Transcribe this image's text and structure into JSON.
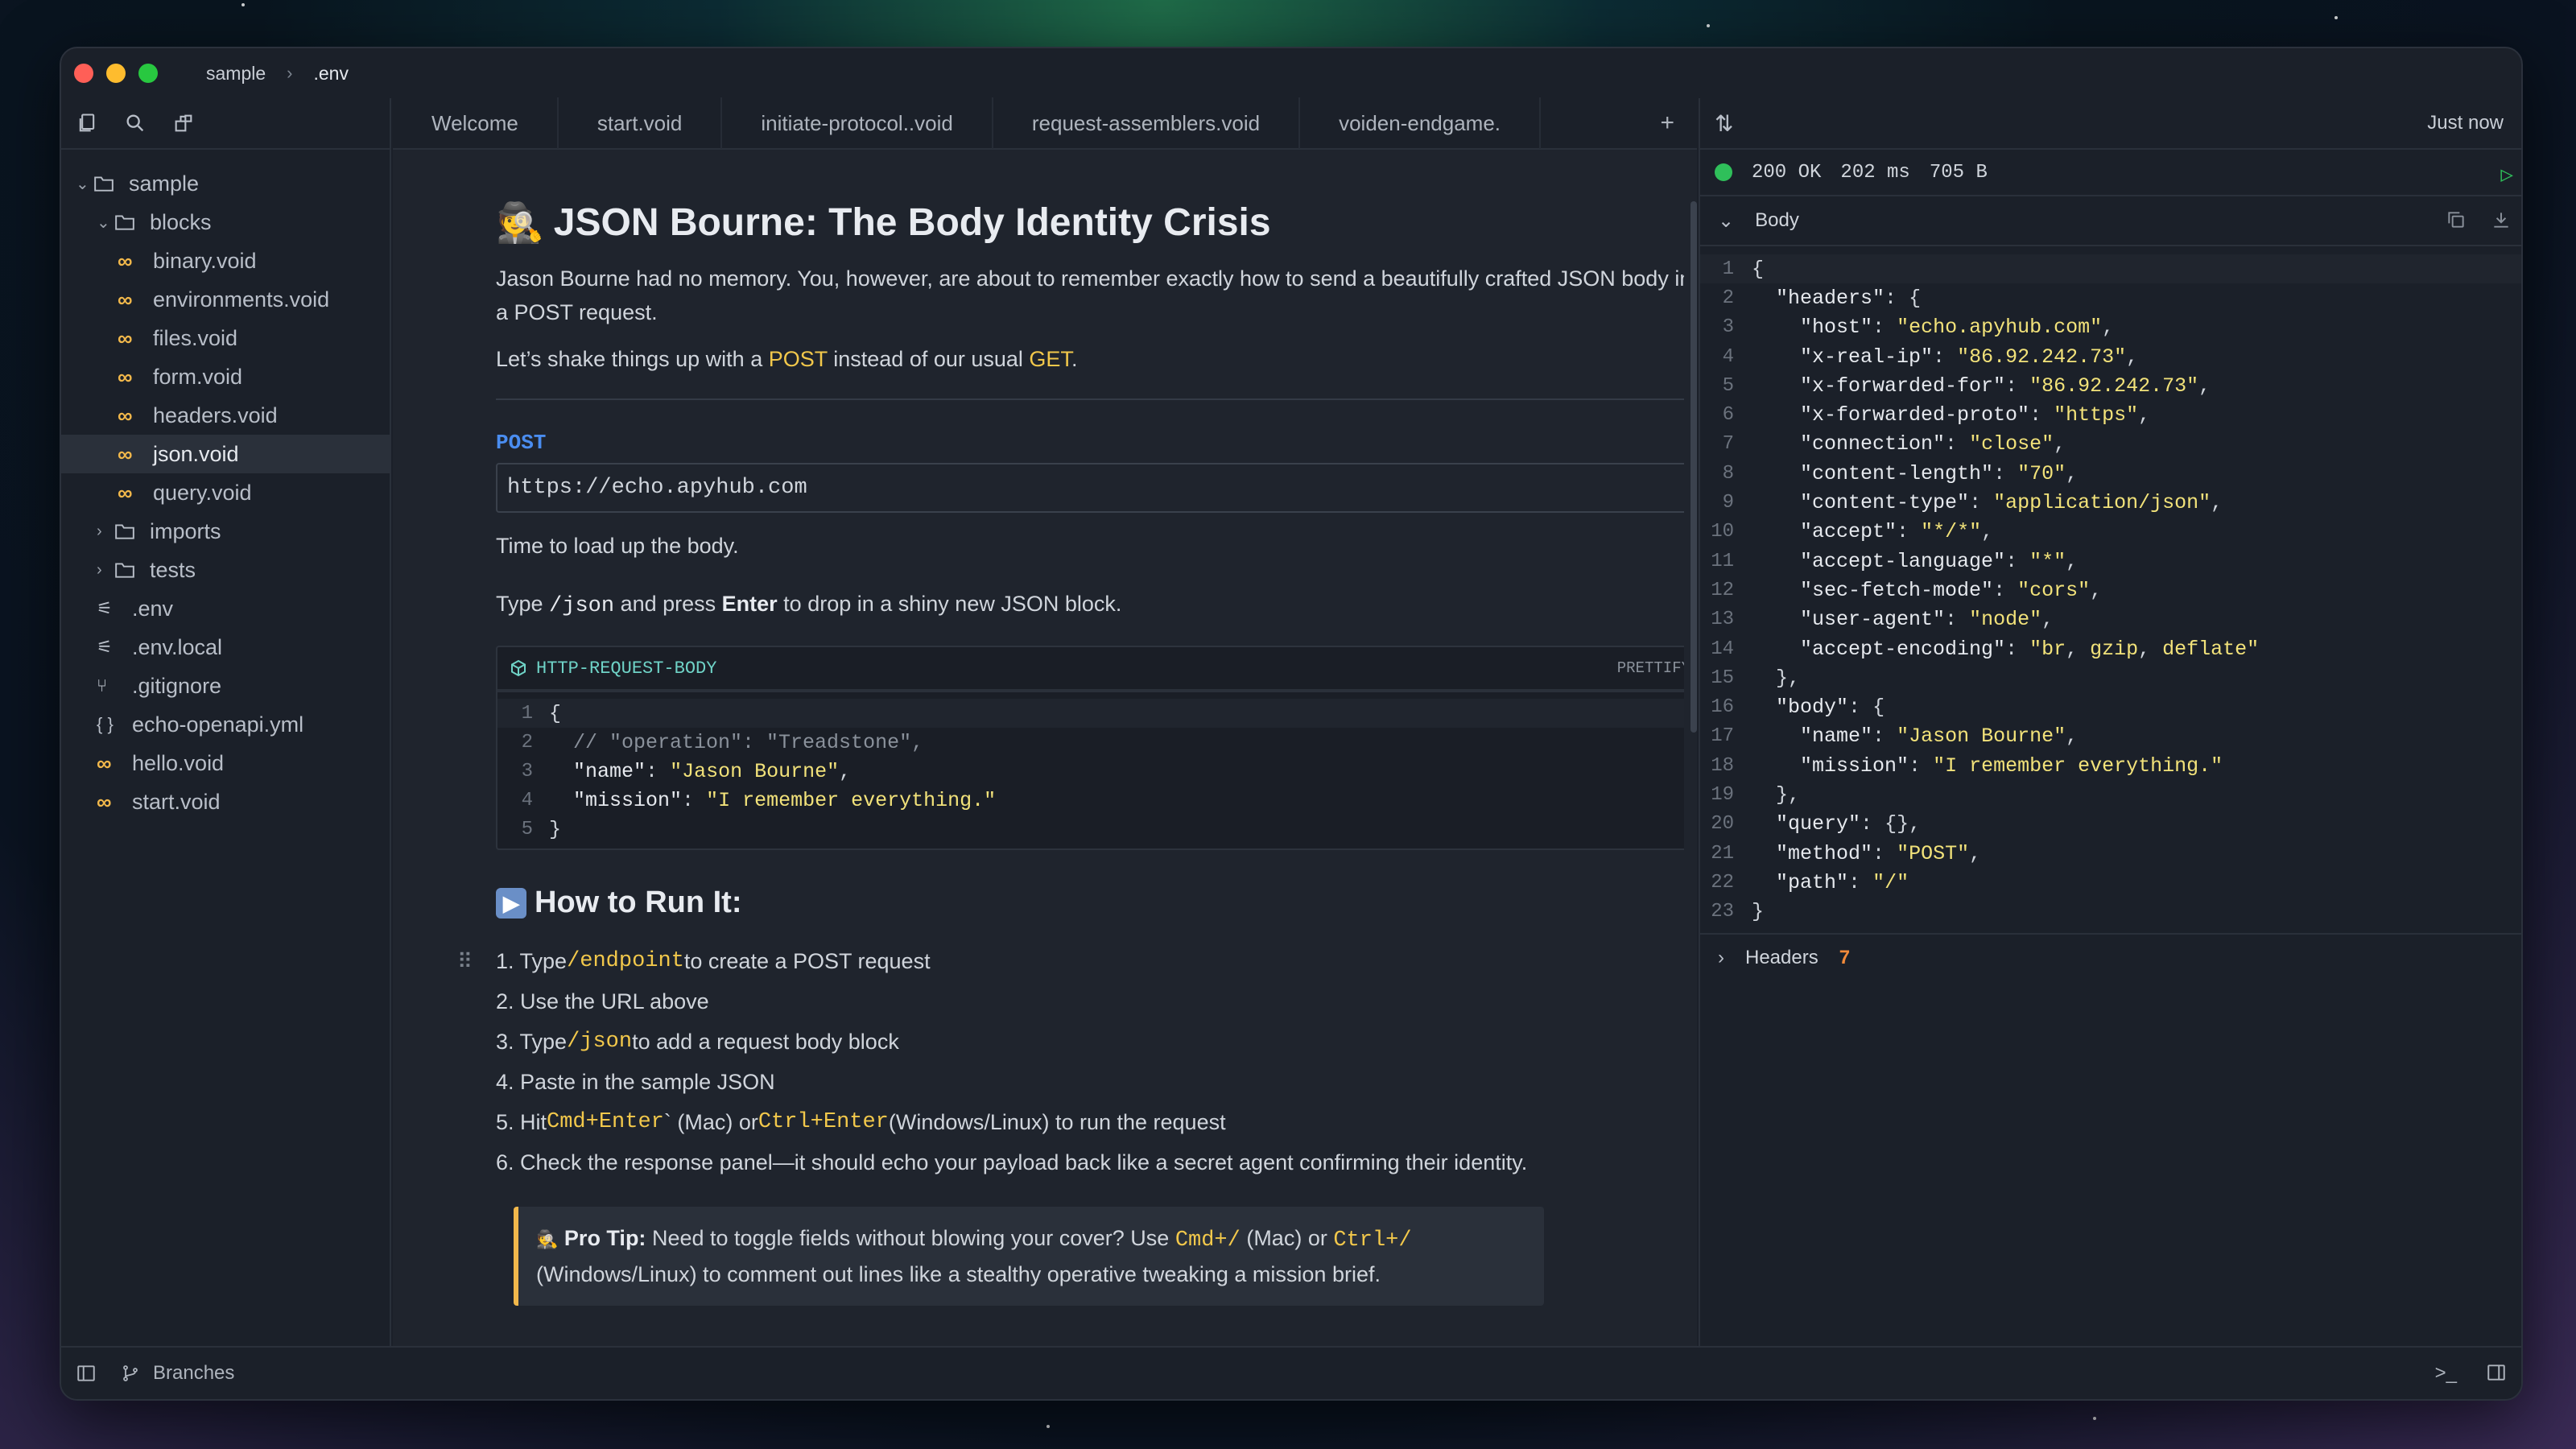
{
  "window": {
    "breadcrumb": [
      "sample",
      ".env"
    ],
    "traffic_colors": [
      "#ff5f57",
      "#febc2e",
      "#28c840"
    ]
  },
  "sidebar": {
    "items": [
      {
        "label": "sample",
        "type": "folder-open",
        "indent": 0
      },
      {
        "label": "blocks",
        "type": "folder-open",
        "indent": 1
      },
      {
        "label": "binary.void",
        "type": "void",
        "indent": 2
      },
      {
        "label": "environments.void",
        "type": "void",
        "indent": 2
      },
      {
        "label": "files.void",
        "type": "void",
        "indent": 2
      },
      {
        "label": "form.void",
        "type": "void",
        "indent": 2
      },
      {
        "label": "headers.void",
        "type": "void",
        "indent": 2
      },
      {
        "label": "json.void",
        "type": "void",
        "indent": 2,
        "active": true
      },
      {
        "label": "query.void",
        "type": "void",
        "indent": 2
      },
      {
        "label": "imports",
        "type": "folder",
        "indent": 1
      },
      {
        "label": "tests",
        "type": "folder",
        "indent": 1
      },
      {
        "label": ".env",
        "type": "env",
        "indent": 1
      },
      {
        "label": ".env.local",
        "type": "env",
        "indent": 1
      },
      {
        "label": ".gitignore",
        "type": "git",
        "indent": 1
      },
      {
        "label": "echo-openapi.yml",
        "type": "yml",
        "indent": 1
      },
      {
        "label": "hello.void",
        "type": "void",
        "indent": 1
      },
      {
        "label": "start.void",
        "type": "void",
        "indent": 1
      }
    ]
  },
  "tabs": [
    "Welcome",
    "start.void",
    "initiate-protocol..void",
    "request-assemblers.void",
    "voiden-endgame."
  ],
  "doc": {
    "title": "JSON Bourne: The Body Identity Crisis",
    "intro": "Jason Bourne had no memory. You, however, are about to remember exactly how to send a beautifully crafted JSON body in a POST request.",
    "shake_pre": "Let’s shake things up with a ",
    "shake_post_code": "POST",
    "shake_mid": " instead of our usual ",
    "shake_get": "GET",
    "shake_end": ".",
    "method": "POST",
    "url": "https://echo.apyhub.com",
    "load_body": "Time to load up the body.",
    "type_pre": "Type ",
    "type_code": "/json",
    "type_mid": " and press ",
    "type_bold": "Enter",
    "type_end": " to drop in a shiny new JSON block.",
    "block_title": "HTTP-REQUEST-BODY",
    "prettify": "PRETTIFY",
    "run_title": "How to Run It:",
    "steps": [
      {
        "num": "1. ",
        "pre": "Type ",
        "code": "/endpoint",
        "post": " to create a POST request"
      },
      {
        "num": "2. ",
        "pre": "Use the URL above",
        "code": "",
        "post": ""
      },
      {
        "num": "3. ",
        "pre": "Type ",
        "code": "/json",
        "post": " to add a request body block"
      },
      {
        "num": "4. ",
        "pre": "Paste in the sample JSON",
        "code": "",
        "post": ""
      },
      {
        "num": "6. ",
        "pre": "Check the response panel—it should echo your payload back like a secret agent confirming their identity.",
        "code": "",
        "post": ""
      }
    ],
    "step5": {
      "num": "5. ",
      "pre": "Hit ",
      "code1": "Cmd+Enter",
      "mid1": "` (Mac) or ",
      "code2": "Ctrl+Enter",
      "post": " (Windows/Linux) to run the request"
    },
    "tip": {
      "label": "Pro Tip:",
      "pre": " Need to toggle fields without blowing your cover? Use ",
      "code1": "Cmd+/",
      "mid": " (Mac) or ",
      "code2": "Ctrl+/",
      "post": " (Windows/Linux) to comment out lines like a stealthy operative tweaking a mission brief."
    }
  },
  "request_body_lines": [
    {
      "n": "1",
      "text": "{"
    },
    {
      "n": "2",
      "text": "  // \"operation\": \"Treadstone\","
    },
    {
      "n": "3",
      "text": "  \"name\": \"Jason Bourne\","
    },
    {
      "n": "4",
      "text": "  \"mission\": \"I remember everything.\""
    },
    {
      "n": "5",
      "text": "}"
    }
  ],
  "response": {
    "when": "Just now",
    "status": "200 OK",
    "time": "202 ms",
    "size": "705 B",
    "body_label": "Body",
    "headers_label": "Headers",
    "headers_count": "7",
    "lines": [
      "{",
      "  \"headers\": {",
      "    \"host\": \"echo.apyhub.com\",",
      "    \"x-real-ip\": \"86.92.242.73\",",
      "    \"x-forwarded-for\": \"86.92.242.73\",",
      "    \"x-forwarded-proto\": \"https\",",
      "    \"connection\": \"close\",",
      "    \"content-length\": \"70\",",
      "    \"content-type\": \"application/json\",",
      "    \"accept\": \"*/*\",",
      "    \"accept-language\": \"*\",",
      "    \"sec-fetch-mode\": \"cors\",",
      "    \"user-agent\": \"node\",",
      "    \"accept-encoding\": \"br, gzip, deflate\"",
      "  },",
      "  \"body\": {",
      "    \"name\": \"Jason Bourne\",",
      "    \"mission\": \"I remember everything.\"",
      "  },",
      "  \"query\": {},",
      "  \"method\": \"POST\",",
      "  \"path\": \"/\"",
      "}"
    ]
  },
  "statusbar": {
    "branches": "Branches"
  }
}
